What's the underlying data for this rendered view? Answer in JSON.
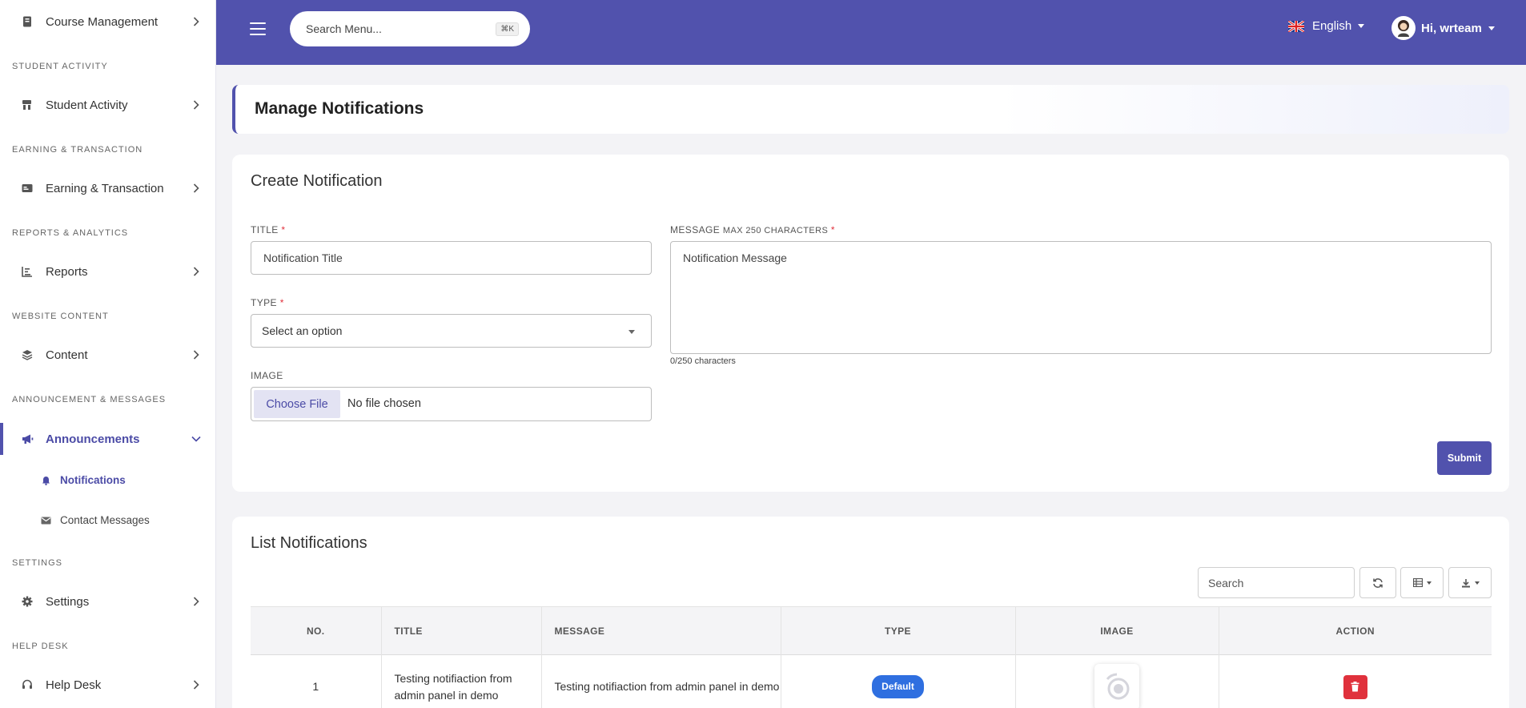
{
  "sidebar": {
    "items": [
      {
        "label": "Course Management"
      },
      {
        "label": "Student Activity"
      },
      {
        "label": "Earning & Transaction"
      },
      {
        "label": "Reports"
      },
      {
        "label": "Content"
      },
      {
        "label": "Announcements"
      },
      {
        "label": "Settings"
      },
      {
        "label": "Help Desk"
      }
    ],
    "sections": [
      "STUDENT ACTIVITY",
      "EARNING & TRANSACTION",
      "REPORTS & ANALYTICS",
      "WEBSITE CONTENT",
      "ANNOUNCEMENT & MESSAGES",
      "SETTINGS",
      "HELP DESK"
    ],
    "subitems": [
      {
        "label": "Notifications"
      },
      {
        "label": "Contact Messages"
      }
    ]
  },
  "topbar": {
    "search_placeholder": "Search Menu...",
    "shortcut": "⌘K",
    "language": "English",
    "greeting": "Hi, wrteam"
  },
  "page": {
    "title": "Manage Notifications"
  },
  "create": {
    "heading": "Create Notification",
    "title_label": "TITLE",
    "title_placeholder": "Notification Title",
    "type_label": "TYPE",
    "type_selected": "Select an option",
    "image_label": "IMAGE",
    "file_button": "Choose File",
    "file_status": "No file chosen",
    "message_label": "MESSAGE",
    "message_hint": "MAX 250 CHARACTERS",
    "message_placeholder": "Notification Message",
    "char_count": "0/250 characters",
    "required_mark": "*",
    "submit": "Submit"
  },
  "list": {
    "heading": "List Notifications",
    "search_placeholder": "Search",
    "columns": [
      "NO.",
      "TITLE",
      "MESSAGE",
      "TYPE",
      "IMAGE",
      "ACTION"
    ],
    "rows": [
      {
        "no": "1",
        "title": "Testing notifiaction from admin panel in demo",
        "message": "Testing notifiaction from admin panel in demo",
        "type": "Default"
      }
    ]
  },
  "colors": {
    "primary": "#5152ad",
    "danger": "#e0313c",
    "badge": "#2f6fe0"
  }
}
